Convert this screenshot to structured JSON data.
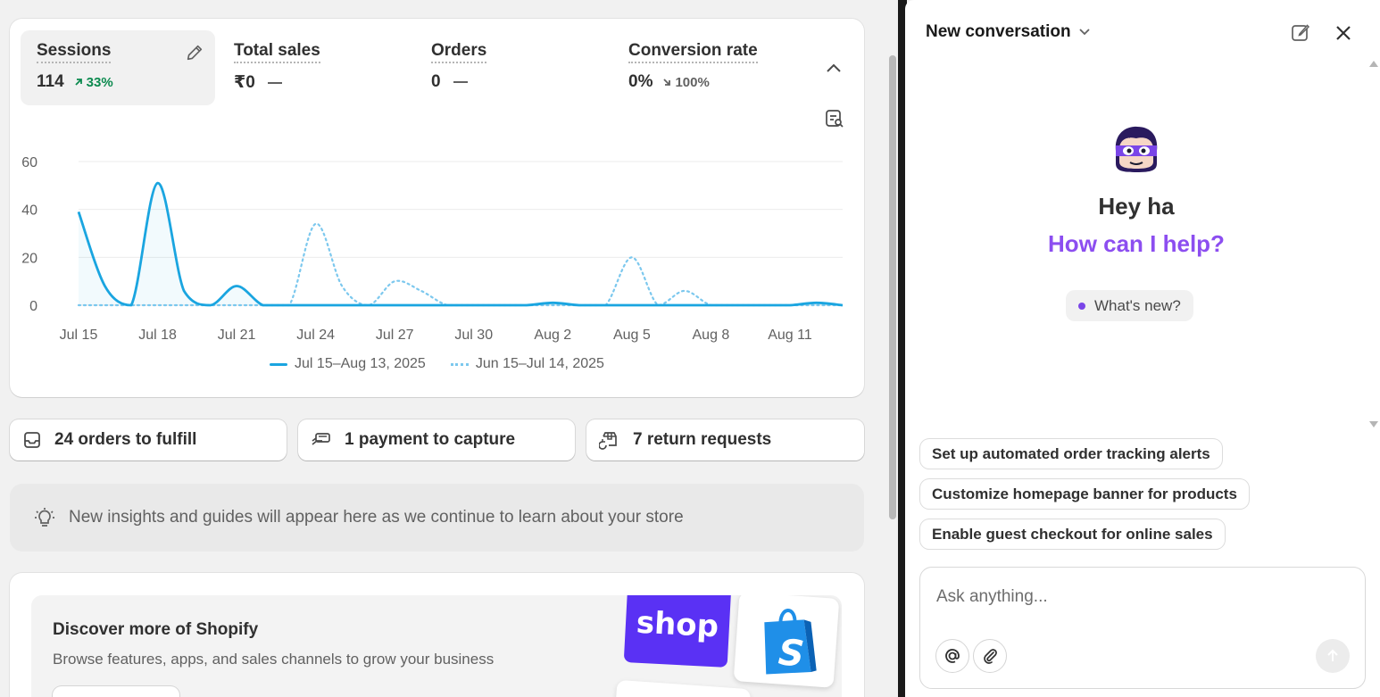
{
  "metrics": [
    {
      "title": "Sessions",
      "value": "114",
      "change": "33%",
      "direction": "up"
    },
    {
      "title": "Total sales",
      "value": "₹0",
      "change": "",
      "direction": "none"
    },
    {
      "title": "Orders",
      "value": "0",
      "change": "",
      "direction": "none"
    },
    {
      "title": "Conversion rate",
      "value": "0%",
      "change": "100%",
      "direction": "down"
    }
  ],
  "chart_data": {
    "type": "line",
    "x": [
      "Jul 15",
      "Jul 16",
      "Jul 17",
      "Jul 18",
      "Jul 19",
      "Jul 20",
      "Jul 21",
      "Jul 22",
      "Jul 23",
      "Jul 24",
      "Jul 25",
      "Jul 26",
      "Jul 27",
      "Jul 28",
      "Jul 29",
      "Jul 30",
      "Jul 31",
      "Aug 1",
      "Aug 2",
      "Aug 3",
      "Aug 4",
      "Aug 5",
      "Aug 6",
      "Aug 7",
      "Aug 8",
      "Aug 9",
      "Aug 10",
      "Aug 11",
      "Aug 12",
      "Aug 13"
    ],
    "xticks": [
      "Jul 15",
      "Jul 18",
      "Jul 21",
      "Jul 24",
      "Jul 27",
      "Jul 30",
      "Aug 2",
      "Aug 5",
      "Aug 8",
      "Aug 11"
    ],
    "yticks": [
      "60",
      "40",
      "20",
      "0"
    ],
    "ylim": [
      0,
      60
    ],
    "series": [
      {
        "name": "Jul 15–Aug 13, 2025",
        "style": "solid",
        "color": "#1aa5e0",
        "values": [
          39,
          8,
          0,
          51,
          6,
          0,
          8,
          0,
          0,
          0,
          0,
          0,
          0,
          0,
          0,
          0,
          0,
          0,
          1,
          0,
          0,
          0,
          0,
          0,
          0,
          0,
          0,
          0,
          1,
          0
        ]
      },
      {
        "name": "Jun 15–Jul 14, 2025",
        "style": "dotted",
        "color": "#7cc8ee",
        "values": [
          0,
          0,
          0,
          0,
          0,
          0,
          0,
          0,
          0,
          34,
          8,
          0,
          10,
          6,
          0,
          0,
          0,
          0,
          0,
          0,
          0,
          20,
          0,
          6,
          0,
          0,
          0,
          0,
          0,
          0
        ]
      }
    ]
  },
  "actions": [
    {
      "label": "24 orders to fulfill",
      "icon": "inbox-icon"
    },
    {
      "label": "1 payment to capture",
      "icon": "payment-icon"
    },
    {
      "label": "7 return requests",
      "icon": "return-icon"
    }
  ],
  "insights": "New insights and guides will appear here as we continue to learn about your store",
  "discover": {
    "title": "Discover more of Shopify",
    "subtitle": "Browse features, apps, and sales channels to grow your business",
    "shop_logo": "shop"
  },
  "panel": {
    "title": "New conversation",
    "greeting": "Hey ha",
    "help": "How can I help?",
    "whats_new": "What's new?",
    "suggestions": [
      "Set up automated order tracking alerts",
      "Customize homepage banner for products",
      "Enable guest checkout for online sales"
    ],
    "input_placeholder": "Ask anything..."
  },
  "colors": {
    "accent": "#8c4ef0",
    "positive": "#0c8a4f",
    "chart_primary": "#1aa5e0",
    "chart_secondary": "#7cc8ee",
    "shop_brand": "#5a31f4"
  }
}
